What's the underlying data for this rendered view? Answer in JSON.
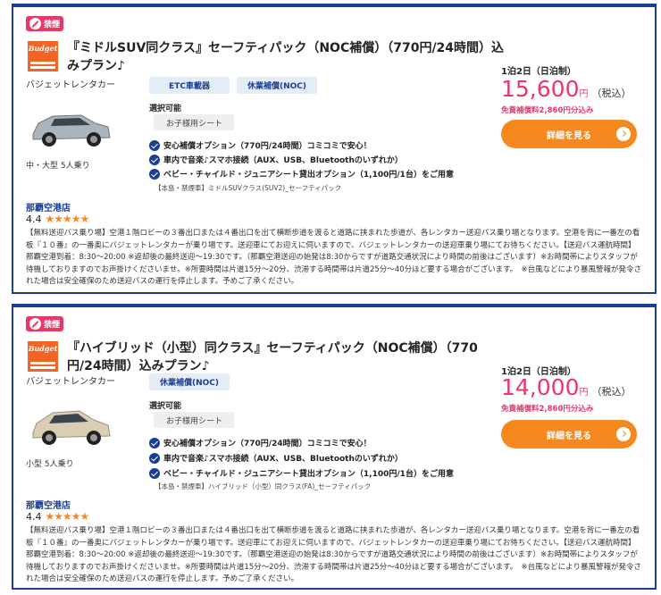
{
  "listings": [
    {
      "badge": "禁煙",
      "logo_text": "Budget",
      "title": "『ミドルSUV同クラス』セーフティパック（NOC補償）（770円/24時間）込みプラン♪",
      "company": "バジェットレンタカー",
      "car_color": "#aab4bc",
      "size_label": "中・大型 5人乗り",
      "tags": [
        "ETC車載器",
        "休業補償(NOC)"
      ],
      "option_label": "選択可能",
      "option_value": "お子様用シート",
      "features": [
        "安心補償オプション（770円/24時間）コミコミで安心！",
        "車内で音楽♪スマホ接続（AUX、USB、Bluetoothのいずれか）",
        "ベビー・チャイルド・ジュニアシート貸出オプション（1,100円/1台）をご用意"
      ],
      "note": "【本島・禁煙車】ミドルSUVクラス(SUV2)_セーフティパック",
      "price_label": "1泊2日（日泊制）",
      "price": "15,600",
      "price_unit": "円",
      "tax": "（税込）",
      "free_text": "免責補償料2,860円分込み",
      "button": "詳細を見る",
      "store": "那覇空港店",
      "rating": "4.4",
      "stars": "★★★★★",
      "description": "【無料送迎バス乗り場】空港１階ロビーの３番出口または４番出口を出て横断歩道を渡ると道路に挟まれた歩道が、各レンタカー送迎バス乗り場となります。空港を背に一番左の看板『１０番』の一番奥にバジェットレンタカーが乗り場です。送迎車にてお迎えに伺いますので、バジェットレンタカーの送迎車乗り場にてお待ちください。【送迎バス運航時間】那覇空港到着：8:30～20:00 ※返却後の最終送迎～19:30です。（那覇空港送迎の始発は8:30からですが道路交通状況により時間の前後はございます）※お時間帯によりスタッフが待機しておりますのでお声掛けくださいませ。※所要時間は片道15分～20分、渋滞する時間帯は片道25分～40分ほど要する場合がございます。　※台風などにより暴風警報が発令された場合は安全確保のため送迎バスの運行を停止します。予めご了承ください。"
    },
    {
      "badge": "禁煙",
      "logo_text": "Budget",
      "title": "『ハイブリッド（小型）同クラス』セーフティパック（NOC補償）（770円/24時間）込みプラン♪",
      "company": "バジェットレンタカー",
      "car_color": "#d9cdb4",
      "size_label": "小型 5人乗り",
      "tags": [
        "休業補償(NOC)"
      ],
      "option_label": "選択可能",
      "option_value": "お子様用シート",
      "features": [
        "安心補償オプション（770円/24時間）コミコミで安心！",
        "車内で音楽♪スマホ接続（AUX、USB、Bluetoothのいずれか）",
        "ベビー・チャイルド・ジュニアシート貸出オプション（1,100円/1台）をご用意"
      ],
      "note": "【本島・禁煙車】ハイブリッド（小型）同クラス(FA)_セーフティパック",
      "price_label": "1泊2日（日泊制）",
      "price": "14,000",
      "price_unit": "円",
      "tax": "（税込）",
      "free_text": "免責補償料2,860円分込み",
      "button": "詳細を見る",
      "store": "那覇空港店",
      "rating": "4.4",
      "stars": "★★★★★",
      "description": "【無料送迎バス乗り場】空港１階ロビーの３番出口または４番出口を出て横断歩道を渡ると道路に挟まれた歩道が、各レンタカー送迎バス乗り場となります。空港を背に一番左の看板『１０番』の一番奥にバジェットレンタカーが乗り場です。送迎車にてお迎えに伺いますので、バジェットレンタカーの送迎車乗り場にてお待ちください。【送迎バス運航時間】那覇空港到着：8:30～20:00 ※返却後の最終送迎～19:30です。（那覇空港送迎の始発は8:30からですが道路交通状況により時間の前後はございます）※お時間帯によりスタッフが待機しておりますのでお声掛けくださいませ。※所要時間は片道15分～20分、渋滞する時間帯は片道25分～40分ほど要する場合がございます。　※台風などにより暴風警報が発令された場合は安全確保のため送迎バスの運行を停止します。予めご了承ください。"
    }
  ]
}
